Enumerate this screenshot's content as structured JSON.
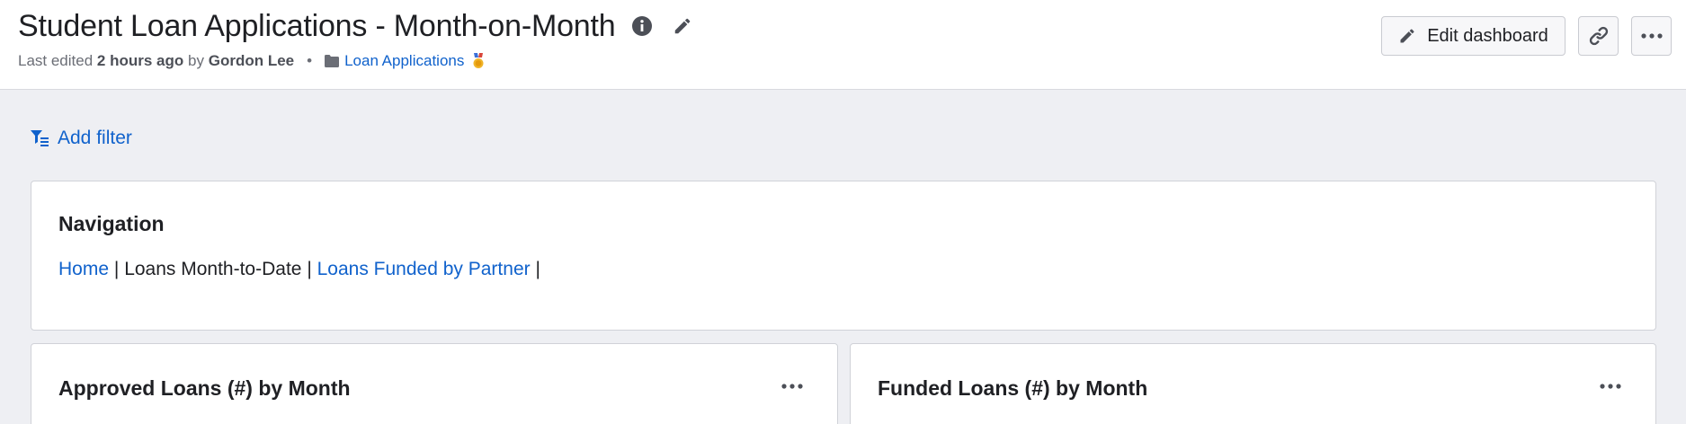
{
  "header": {
    "title": "Student Loan Applications - Month-on-Month",
    "meta": {
      "last_edited_prefix": "Last edited",
      "time": "2 hours ago",
      "by_word": "by",
      "author": "Gordon Lee",
      "separator": "•",
      "collection": "Loan Applications",
      "collection_badge": "🎖"
    },
    "actions": {
      "edit_label": "Edit dashboard",
      "link_icon": "link-icon",
      "more_icon": "more-icon"
    },
    "icons": {
      "info": "info-icon",
      "edit": "pencil-icon"
    }
  },
  "filters": {
    "add_label": "Add filter"
  },
  "navigation_card": {
    "title": "Navigation",
    "links": [
      {
        "label": "Home",
        "is_link": true
      },
      {
        "label": "Loans Month-to-Date",
        "is_link": false
      },
      {
        "label": "Loans Funded by Partner",
        "is_link": true
      }
    ],
    "separator": "|"
  },
  "cards": [
    {
      "title": "Approved Loans (#) by Month"
    },
    {
      "title": "Funded Loans (#) by Month"
    }
  ],
  "colors": {
    "accent": "#1062cc",
    "background": "#eeeff3",
    "text": "#1f2024",
    "muted": "#6b6e76"
  }
}
